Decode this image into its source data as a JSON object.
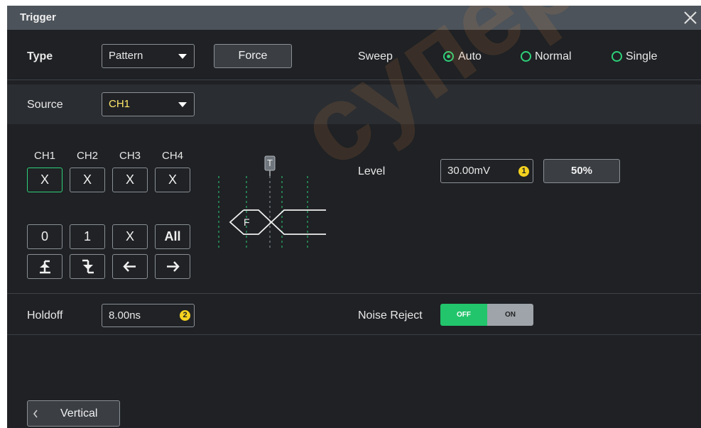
{
  "window": {
    "title": "Trigger"
  },
  "type": {
    "label": "Type",
    "value": "Pattern"
  },
  "force_label": "Force",
  "sweep": {
    "label": "Sweep",
    "options": [
      {
        "label": "Auto",
        "selected": true
      },
      {
        "label": "Normal",
        "selected": false
      },
      {
        "label": "Single",
        "selected": false
      }
    ]
  },
  "source": {
    "label": "Source",
    "value": "CH1"
  },
  "channels": {
    "labels": [
      "CH1",
      "CH2",
      "CH3",
      "CH4"
    ],
    "values": [
      "X",
      "X",
      "X",
      "X"
    ],
    "selected": "CH1"
  },
  "pattern_buttons": [
    "0",
    "1",
    "X",
    "All"
  ],
  "edge_buttons": [
    "rising-edge-icon",
    "falling-edge-icon",
    "arrow-left-icon",
    "arrow-right-icon"
  ],
  "diagram": {
    "marker": "T",
    "bus_label": "F"
  },
  "level": {
    "label": "Level",
    "value": "30.00mV",
    "badge": "1",
    "button": "50%"
  },
  "holdoff": {
    "label": "Holdoff",
    "value": "8.00ns",
    "badge": "2"
  },
  "noise_reject": {
    "label": "Noise Reject",
    "off_label": "OFF",
    "on_label": "ON",
    "state": "OFF"
  },
  "back_button": {
    "label": "Vertical",
    "icon": "chevron-left-icon"
  },
  "watermark": "суперайс",
  "colors": {
    "accent_green": "#2ed17a",
    "badge_yellow": "#f4d21f",
    "source_text": "#ffe86a",
    "panel_bg": "#1f2124",
    "titlebar_bg": "#4c535a"
  }
}
